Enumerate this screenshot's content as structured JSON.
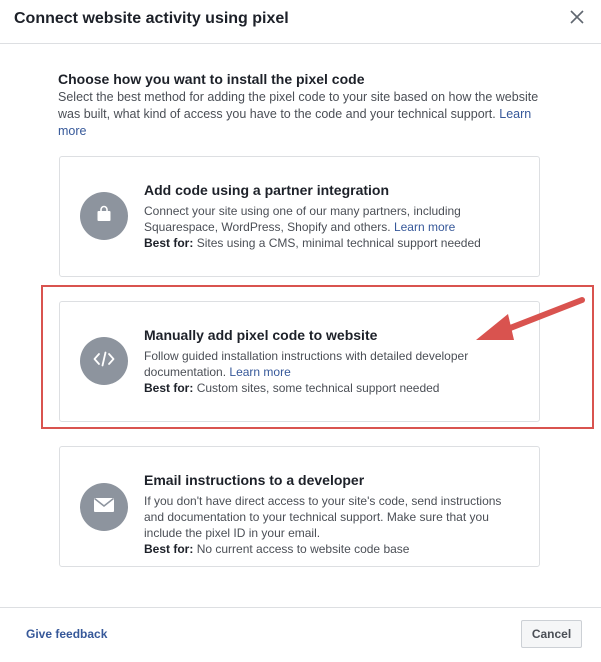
{
  "dialog": {
    "title": "Connect website activity using pixel"
  },
  "intro": {
    "heading": "Choose how you want to install the pixel code",
    "description": "Select the best method for adding the pixel code to your site based on how the website was built, what kind of access you have to the code and your technical support.",
    "learn_more": "Learn more"
  },
  "options": [
    {
      "title": "Add code using a partner integration",
      "body": "Connect your site using one of our many partners, including Squarespace, WordPress, Shopify and others.",
      "learn_more": "Learn more",
      "best_for_label": "Best for:",
      "best_for": "Sites using a CMS, minimal technical support needed",
      "icon": "shopping-bag-icon"
    },
    {
      "title": "Manually add pixel code to website",
      "body": "Follow guided installation instructions with detailed developer documentation.",
      "learn_more": "Learn more",
      "best_for_label": "Best for:",
      "best_for": "Custom sites, some technical support needed",
      "icon": "code-icon"
    },
    {
      "title": "Email instructions to a developer",
      "body": "If you don't have direct access to your site's code, send instructions and documentation to your technical support. Make sure that you include the pixel ID in your email.",
      "best_for_label": "Best for:",
      "best_for": "No current access to website code base",
      "icon": "envelope-icon"
    }
  ],
  "footer": {
    "feedback": "Give feedback",
    "cancel": "Cancel"
  },
  "colors": {
    "highlight": "#d9534f",
    "icon_bg": "#8d949e",
    "link": "#365899"
  }
}
